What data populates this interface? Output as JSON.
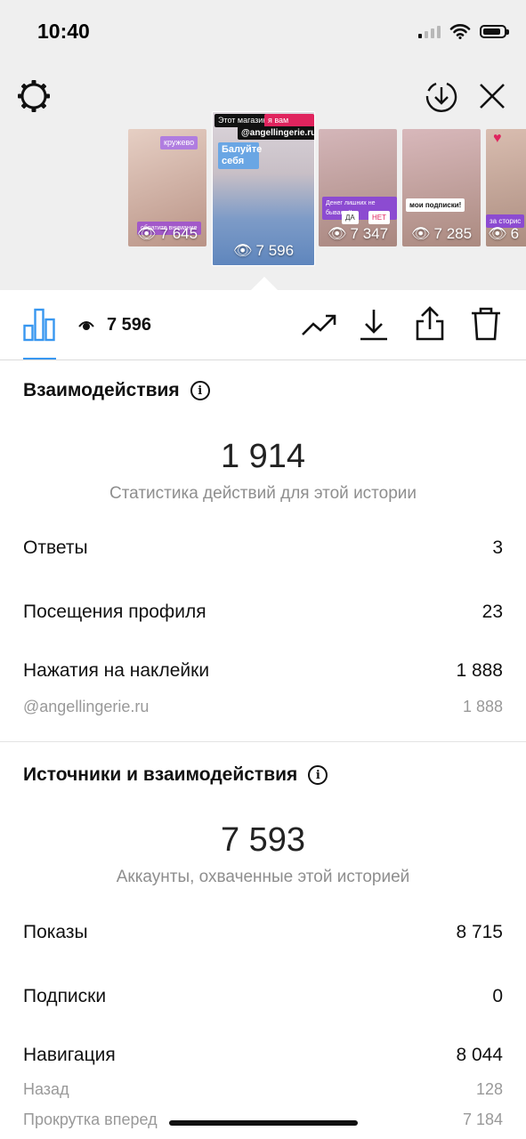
{
  "status_bar": {
    "time": "10:40",
    "battery_level": 0.85
  },
  "header": {
    "settings_icon": "gear-icon",
    "download_icon": "download-circle-icon",
    "close_icon": "close-icon"
  },
  "thumbnails": [
    {
      "views": "7 645",
      "sticker": "кружево",
      "note": "обратите внимание",
      "bg": "#d8b9ad"
    },
    {
      "views": "7 596",
      "top_left": "Этот магазинчик",
      "top_right": "я вам советую",
      "mention": "@angellingerie.ru",
      "cta": "Балуйте себя",
      "bg": "#b7a9b1",
      "selected": true
    },
    {
      "views": "7 347",
      "banner": "Денег лишних не бывает !!",
      "opt_yes": "ДА",
      "opt_no": "НЕТ",
      "bg": "#c9a8a0"
    },
    {
      "views": "7 285",
      "banner": "мои подписки!",
      "bg": "#c5a29a"
    },
    {
      "views": "6",
      "banner": "за сторис",
      "bg": "#cdb2a6"
    }
  ],
  "toolbar": {
    "views": "7 596",
    "icons": [
      "bar-chart-icon",
      "eye-icon",
      "trend-icon",
      "download-icon",
      "share-icon",
      "trash-icon"
    ],
    "accent": "#3897f0"
  },
  "interactions": {
    "title": "Взаимодействия",
    "total": "1 914",
    "caption": "Статистика действий для этой истории",
    "rows": [
      {
        "label": "Ответы",
        "value": "3"
      },
      {
        "label": "Посещения профиля",
        "value": "23"
      },
      {
        "label": "Нажатия на наклейки",
        "value": "1 888"
      }
    ],
    "sub_row": {
      "label": "@angellingerie.ru",
      "value": "1 888"
    }
  },
  "sources": {
    "title": "Источники и взаимодействия",
    "total": "7 593",
    "caption": "Аккаунты, охваченные этой историей",
    "rows": [
      {
        "label": "Показы",
        "value": "8 715"
      },
      {
        "label": "Подписки",
        "value": "0"
      },
      {
        "label": "Навигация",
        "value": "8 044"
      }
    ],
    "sub_rows": [
      {
        "label": "Назад",
        "value": "128"
      },
      {
        "label": "Прокрутка вперед",
        "value": "7 184"
      }
    ]
  }
}
